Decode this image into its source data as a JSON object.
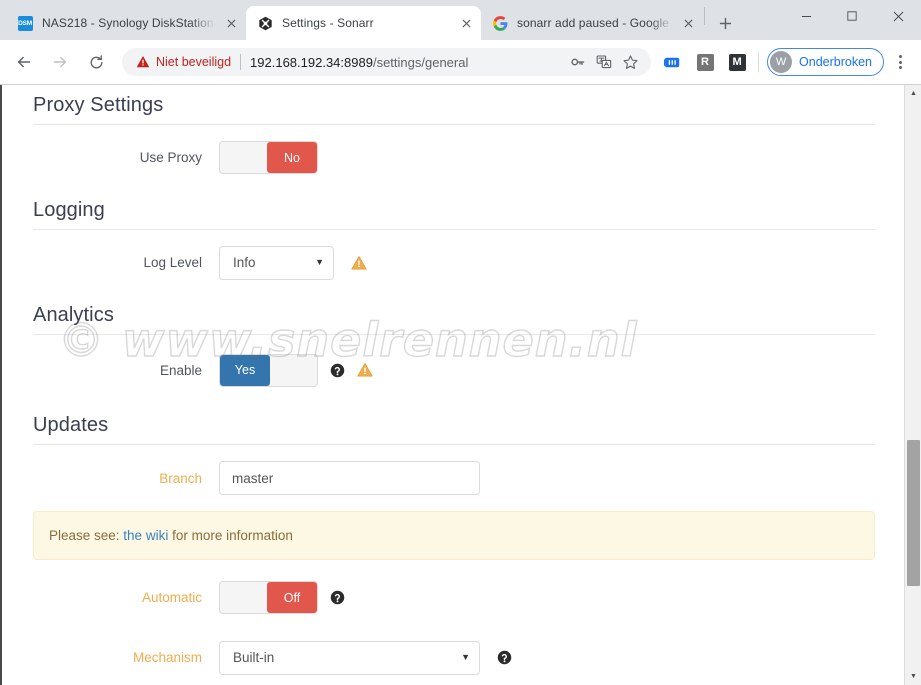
{
  "browser": {
    "tabs": [
      {
        "title": "NAS218 - Synology DiskStation",
        "favicon": "dsm-icon",
        "favicon_text": "DSM",
        "active": false
      },
      {
        "title": "Settings - Sonarr",
        "favicon": "sonarr-icon",
        "active": true
      },
      {
        "title": "sonarr add paused - Google zo",
        "favicon": "google-icon",
        "active": false
      }
    ],
    "new_tab_label": "+",
    "window_controls": {
      "minimize": "minimize-icon",
      "maximize": "maximize-icon",
      "close": "close-icon"
    },
    "toolbar": {
      "back": "back-arrow-icon",
      "forward": "forward-arrow-icon",
      "reload": "reload-icon",
      "security_label": "Niet beveiligd",
      "url_host": "192.168.192.34:8989",
      "url_path": "/settings/general",
      "omnibox_icons": [
        "key-icon",
        "translate-icon",
        "bookmark-star-icon"
      ],
      "extension_icons": [
        "reading-list-icon",
        "r-extension-icon",
        "m-extension-icon"
      ],
      "extension_r_label": "R",
      "extension_m_label": "M",
      "profile_initial": "W",
      "profile_label": "Onderbroken",
      "menu": "three-dots-menu-icon"
    },
    "colors": {
      "security_warning": "#c5221f",
      "profile_accent": "#1a73e8",
      "tabstrip_bg": "#dee1e6"
    }
  },
  "watermark": {
    "text": "© www.snelrennen.nl"
  },
  "page": {
    "sections": [
      {
        "id": "proxy",
        "title": "Proxy Settings",
        "rows": [
          {
            "label": "Use Proxy",
            "advanced": false,
            "control": "toggle",
            "toggle_state": "off",
            "toggle_text": "No",
            "has_help": false,
            "has_warning": false
          }
        ]
      },
      {
        "id": "logging",
        "title": "Logging",
        "rows": [
          {
            "label": "Log Level",
            "advanced": false,
            "control": "select",
            "value": "Info",
            "has_help": false,
            "has_warning": true
          }
        ]
      },
      {
        "id": "analytics",
        "title": "Analytics",
        "rows": [
          {
            "label": "Enable",
            "advanced": false,
            "control": "toggle",
            "toggle_state": "on",
            "toggle_text": "Yes",
            "has_help": true,
            "has_warning": true
          }
        ]
      },
      {
        "id": "updates",
        "title": "Updates",
        "rows": [
          {
            "label": "Branch",
            "advanced": true,
            "control": "text",
            "value": "master",
            "has_help": false,
            "has_warning": false
          }
        ]
      }
    ],
    "alert": {
      "prefix": "Please see: ",
      "link_text": "the wiki",
      "suffix": " for more information"
    },
    "updates_extra_rows": [
      {
        "label": "Automatic",
        "advanced": true,
        "control": "toggle",
        "toggle_state": "off",
        "toggle_text": "Off",
        "has_help": true,
        "has_warning": false
      },
      {
        "label": "Mechanism",
        "advanced": true,
        "control": "select",
        "value": "Built-in",
        "has_help": true,
        "has_warning": false
      }
    ],
    "colors": {
      "toggle_off": "#e2574c",
      "toggle_on": "#3575ad",
      "advanced_label": "#f0ad4e",
      "alert_bg": "#fcf8e3",
      "alert_border": "#faebcc",
      "alert_text": "#8a6d3b",
      "link": "#3a7fc1",
      "heading": "#3a3f51"
    },
    "scrollbar": {
      "up_arrow": "scroll-up-icon",
      "down_arrow": "scroll-down-icon"
    }
  }
}
